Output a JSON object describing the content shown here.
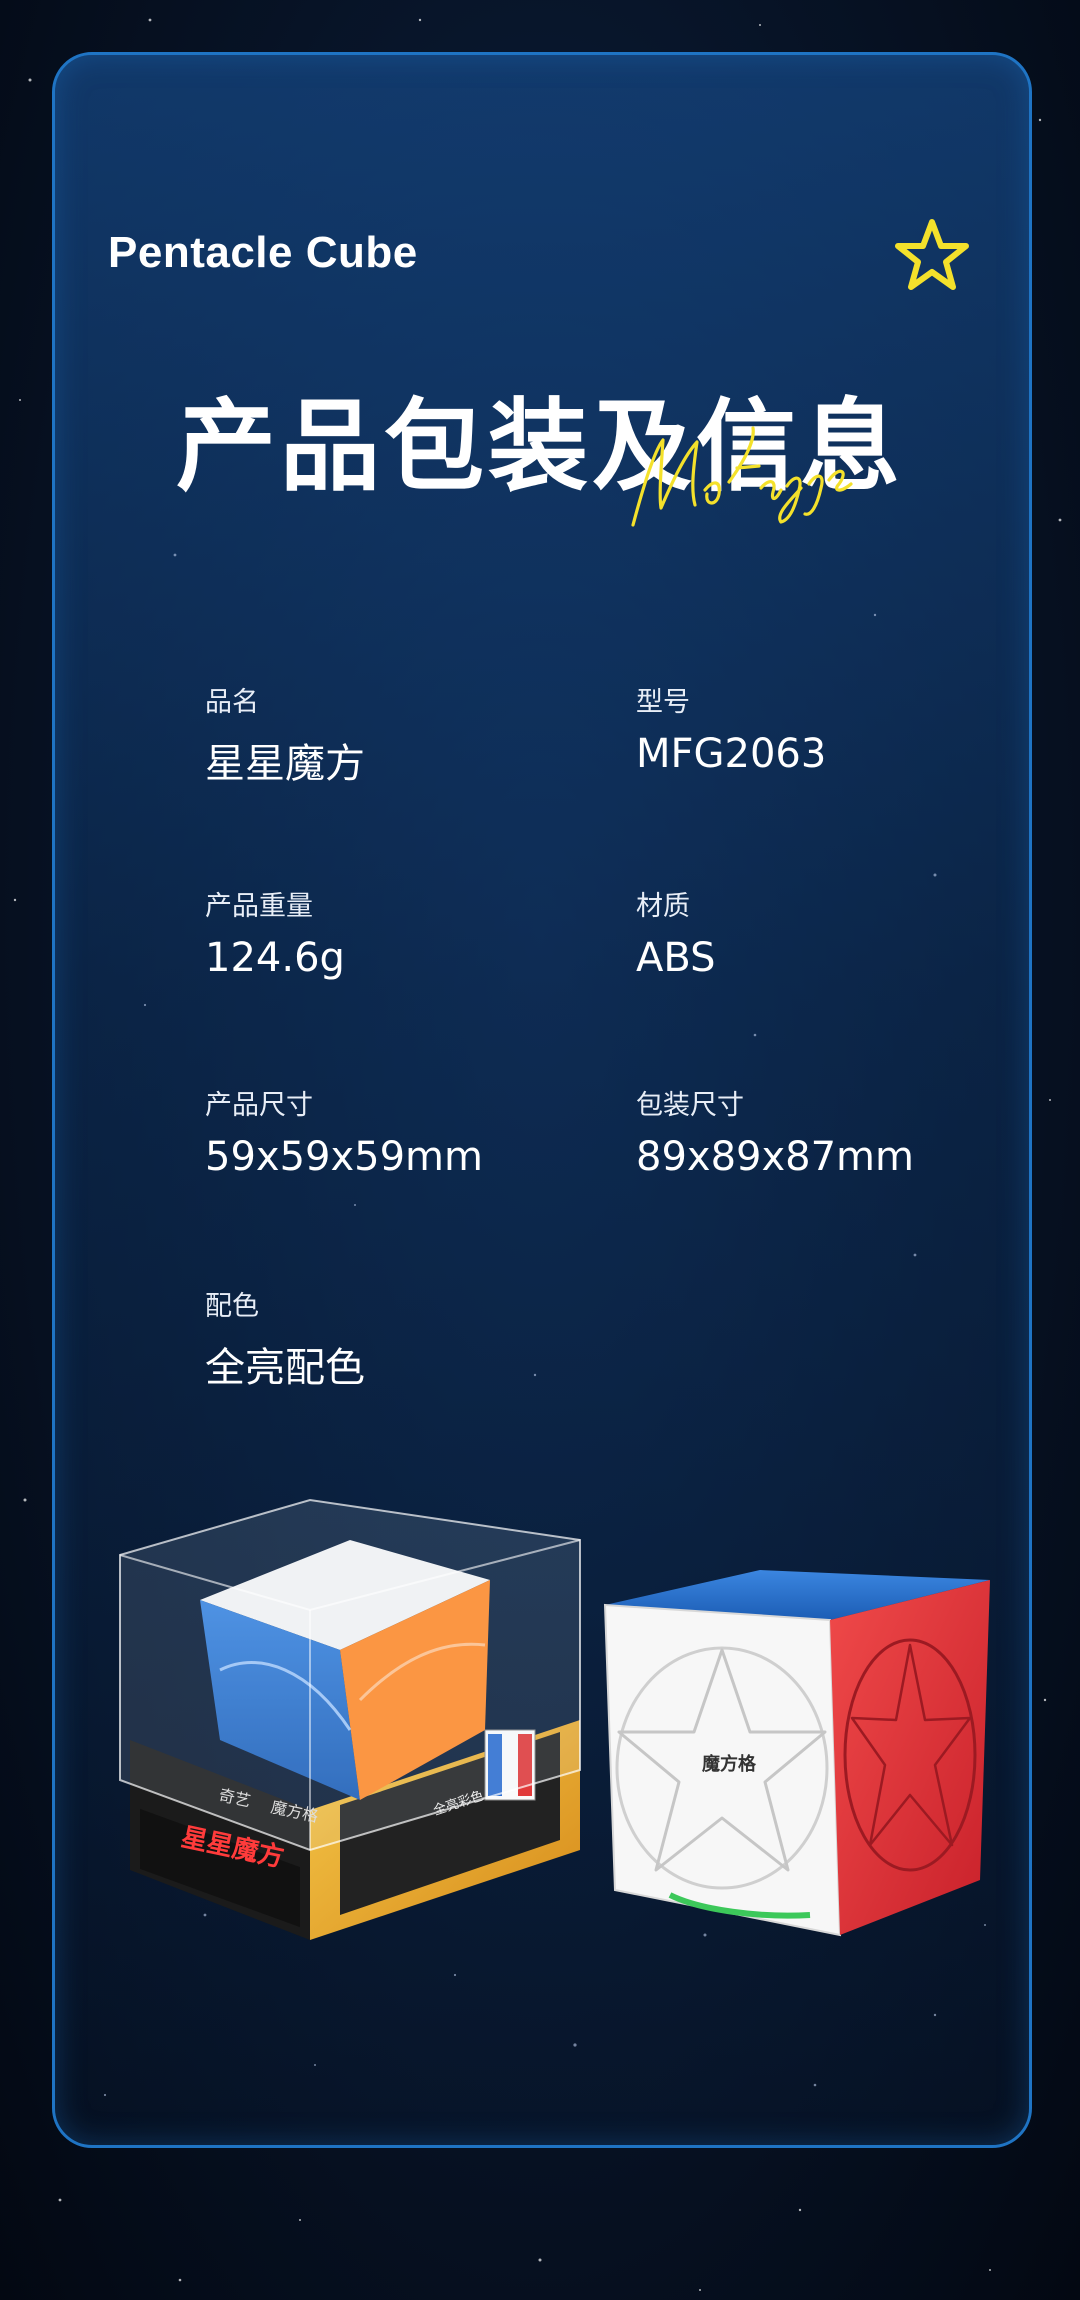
{
  "brand_title": "Pentacle Cube",
  "headline": "产品包装及信息",
  "script_text": "MoFangGe",
  "specs": [
    {
      "label": "品名",
      "value": "星星魔方"
    },
    {
      "label": "型号",
      "value": "MFG2063"
    },
    {
      "label": "产品重量",
      "value": "124.6g"
    },
    {
      "label": "材质",
      "value": "ABS"
    },
    {
      "label": "产品尺寸",
      "value": "59x59x59mm"
    },
    {
      "label": "包装尺寸",
      "value": "89x89x87mm"
    },
    {
      "label": "配色",
      "value": "全亮配色"
    }
  ],
  "package_text": {
    "brand_cn": "奇艺",
    "brand_cn2": "魔方格",
    "product_cn": "星星魔方",
    "color_badge": "全亮彩色"
  },
  "cube_logo_text": "魔方格",
  "colors": {
    "accent": "#f4e12b",
    "card_border": "#1f74c4",
    "bg_dark": "#071326"
  }
}
